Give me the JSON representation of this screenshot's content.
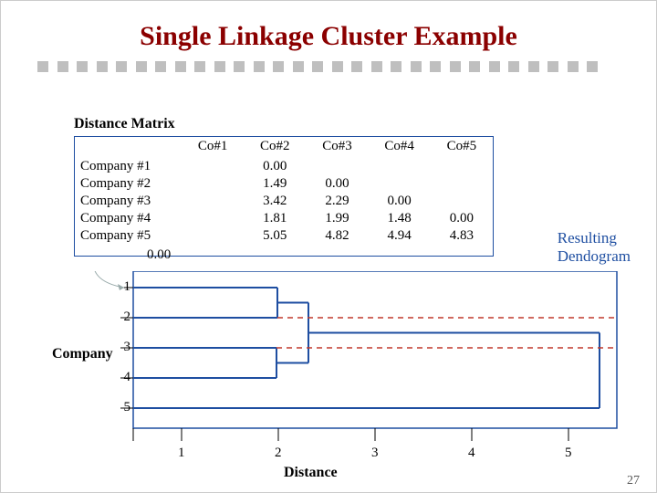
{
  "title": "Single Linkage Cluster Example",
  "matrix_label": "Distance Matrix",
  "dendro_label1": "Resulting",
  "dendro_label2": "Dendogram",
  "y_axis_label": "Company",
  "x_axis_label": "Distance",
  "page_number": "27",
  "orphan_zero": "0.00",
  "col_headers": {
    "c1": "Co#1",
    "c2": "Co#2",
    "c3": "Co#3",
    "c4": "Co#4",
    "c5": "Co#5"
  },
  "rows": {
    "r1": {
      "label": "Company #1",
      "v1": "",
      "v2": "0.00",
      "v3": "",
      "v4": "",
      "v5": ""
    },
    "r2": {
      "label": "Company #2",
      "v1": "",
      "v2": "1.49",
      "v3": "0.00",
      "v4": "",
      "v5": ""
    },
    "r3": {
      "label": "Company #3",
      "v1": "",
      "v2": "3.42",
      "v3": "2.29",
      "v4": "0.00",
      "v5": ""
    },
    "r4": {
      "label": "Company #4",
      "v1": "",
      "v2": "1.81",
      "v3": "1.99",
      "v4": "1.48",
      "v5": "0.00"
    },
    "r5": {
      "label": "Company #5",
      "v1": "",
      "v2": "5.05",
      "v3": "4.82",
      "v4": "4.94",
      "v5": "4.83"
    }
  },
  "x_ticks": {
    "t1": "1",
    "t2": "2",
    "t3": "3",
    "t4": "4",
    "t5": "5"
  },
  "y_ticks": {
    "t1": "1",
    "t2": "2",
    "t3": "3",
    "t4": "4",
    "t5": "5"
  },
  "chart_data": {
    "type": "dendrogram",
    "leaves": [
      1,
      2,
      3,
      4,
      5
    ],
    "merges": [
      {
        "a": 3,
        "b": 4,
        "distance": 1.48
      },
      {
        "a": 1,
        "b": 2,
        "distance": 1.49
      },
      {
        "a": "(1,2)",
        "b": "(3,4)",
        "distance": 1.81
      },
      {
        "a": "(1,2,3,4)",
        "b": 5,
        "distance": 4.82
      }
    ],
    "x_range": [
      0,
      5
    ],
    "title": "Resulting Dendogram",
    "x_label": "Distance",
    "y_label": "Company"
  }
}
